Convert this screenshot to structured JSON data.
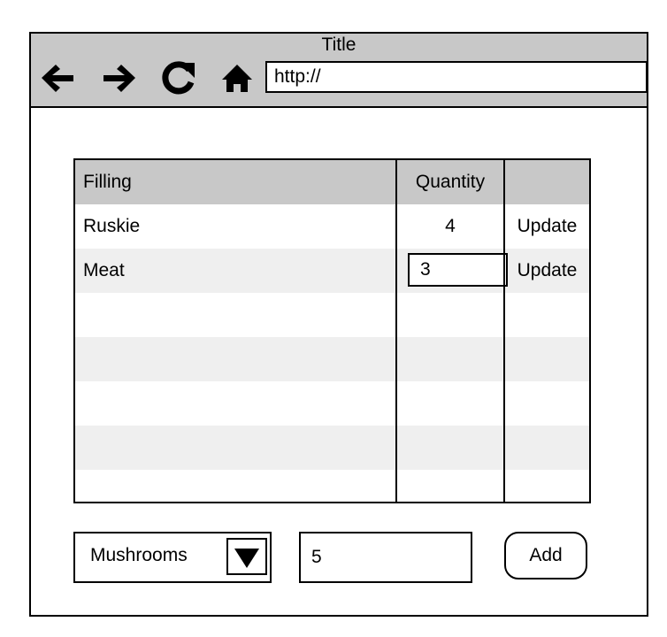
{
  "window": {
    "title": "Title",
    "url": "http://",
    "nav_icons": [
      "back-arrow-icon",
      "forward-arrow-icon",
      "refresh-icon",
      "home-icon"
    ]
  },
  "grid": {
    "columns": [
      "Filling",
      "Quantity",
      ""
    ],
    "rows": [
      {
        "filling": "Ruskie",
        "quantity": "4",
        "action": "Update",
        "editing": false
      },
      {
        "filling": "Meat",
        "quantity": "3",
        "action": "Update",
        "editing": true
      }
    ]
  },
  "add_form": {
    "filling_select": {
      "selected": "Mushrooms"
    },
    "quantity_value": "5",
    "add_label": "Add"
  }
}
